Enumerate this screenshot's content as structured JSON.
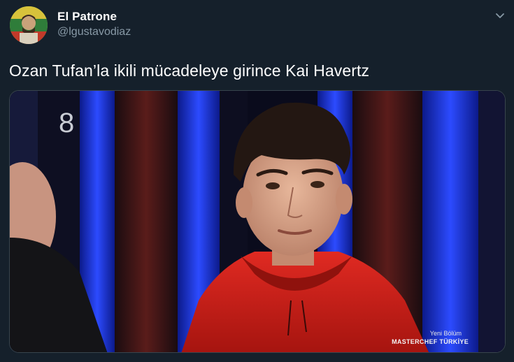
{
  "tweet": {
    "display_name": "El Patrone",
    "handle": "@lgustavodiaz",
    "text": "Ozan Tufan’la ikili mücadeleye girince Kai Havertz",
    "menu_icon": "chevron-down-icon"
  },
  "media": {
    "stage_number": "8",
    "watermark_small": "Yeni Bölüm",
    "watermark_brand": "MASTERCHEF TÜRKİYE"
  },
  "colors": {
    "background": "#15202b",
    "text_primary": "#ffffff",
    "text_secondary": "#8899a6",
    "border": "#38444d"
  }
}
